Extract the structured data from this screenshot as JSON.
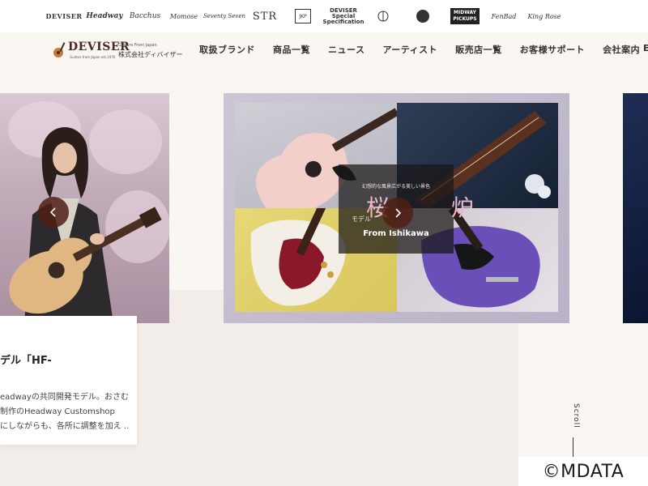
{
  "brand_strip": {
    "logos": [
      {
        "name": "deviser",
        "text": "DEVISER"
      },
      {
        "name": "headway",
        "text": "Headway"
      },
      {
        "name": "bacchus",
        "text": "Bacchus"
      },
      {
        "name": "momose",
        "text": "Momose"
      },
      {
        "name": "seventy-seven",
        "text": "Seventy Seven"
      },
      {
        "name": "str",
        "text": "STR"
      },
      {
        "name": "jkp",
        "text": "JKP"
      },
      {
        "name": "dss",
        "line1": "DEVISER",
        "line2": "Special",
        "line3": "Specification"
      },
      {
        "name": "tama",
        "text": ""
      },
      {
        "name": "round-logo",
        "text": ""
      },
      {
        "name": "pickups",
        "line1": "MIDWAY",
        "line2": "PICKUPS"
      },
      {
        "name": "fenbad",
        "text": "FenBad"
      },
      {
        "name": "king-rose",
        "text": "King Rose"
      }
    ]
  },
  "header": {
    "logo": {
      "wordmark": "DEVISER",
      "tagline": "Guitars from Japan est.1976",
      "sub_en": "Guitars From Japan",
      "sub_jp": "株式会社ディバイザー"
    },
    "nav": [
      {
        "name": "brands",
        "label": "取扱ブランド"
      },
      {
        "name": "products",
        "label": "商品一覧"
      },
      {
        "name": "news",
        "label": "ニュース"
      },
      {
        "name": "artists",
        "label": "アーティスト"
      },
      {
        "name": "dealers",
        "label": "販売店一覧"
      },
      {
        "name": "support",
        "label": "お客様サポート"
      },
      {
        "name": "company",
        "label": "会社案内"
      }
    ],
    "nav_cut": "E"
  },
  "carousel": {
    "center": {
      "tagline": "幻想的な風景広がる美しい景色",
      "kanji": "桜 炉",
      "model": "モデル",
      "from": "From Ishikawa"
    },
    "prev_icon": "chevron-left-icon",
    "next_icon": "chevron-right-icon"
  },
  "caption": {
    "title": "デル「HF-",
    "lines": [
      "eadwayの共同開発モデル。おさむ",
      "制作のHeadway Customshop",
      "にしながらも、各所に調整を加え …"
    ]
  },
  "scroll": {
    "label": "Scroll"
  },
  "watermark": "©MDATA",
  "colors": {
    "page_bg": "#faf6f2",
    "arrow_bg": "#501e14",
    "logo_brown": "#4a2a1a",
    "kanji_pink": "#f2b8c8"
  }
}
